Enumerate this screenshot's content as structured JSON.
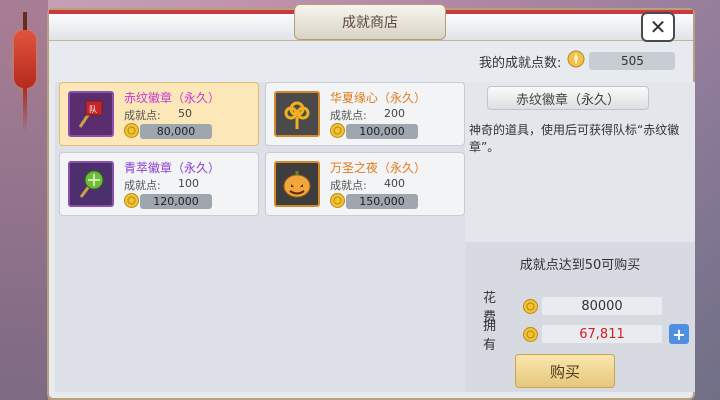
{
  "window": {
    "title": "成就商店",
    "close_icon": "✕"
  },
  "points": {
    "label": "我的成就点数:",
    "value": "505"
  },
  "items": [
    {
      "name": "赤纹徽章（永久）",
      "points_label": "成就点:",
      "points": "50",
      "price": "80,000",
      "name_color": "#c23bd0",
      "icon": "red-banner-badge",
      "selected": true
    },
    {
      "name": "华夏缘心（永久）",
      "points_label": "成就点:",
      "points": "200",
      "price": "100,000",
      "name_color": "#e07a1a",
      "icon": "gold-knot",
      "selected": false
    },
    {
      "name": "青萃徽章（永久）",
      "points_label": "成就点:",
      "points": "100",
      "price": "120,000",
      "name_color": "#8a3bd0",
      "icon": "green-leaf-badge",
      "selected": false
    },
    {
      "name": "万圣之夜（永久）",
      "points_label": "成就点:",
      "points": "400",
      "price": "150,000",
      "name_color": "#e07a1a",
      "icon": "pumpkin",
      "selected": false
    }
  ],
  "detail": {
    "name": "赤纹徽章（永久）",
    "description": "神奇的道具，使用后可获得队标“赤纹徽章”。",
    "requirement": "成就点达到50可购买",
    "cost_label": "花费",
    "cost_value": "80000",
    "own_label": "拥有",
    "own_value": "67,811",
    "buy_label": "购买",
    "plus_icon": "+"
  }
}
